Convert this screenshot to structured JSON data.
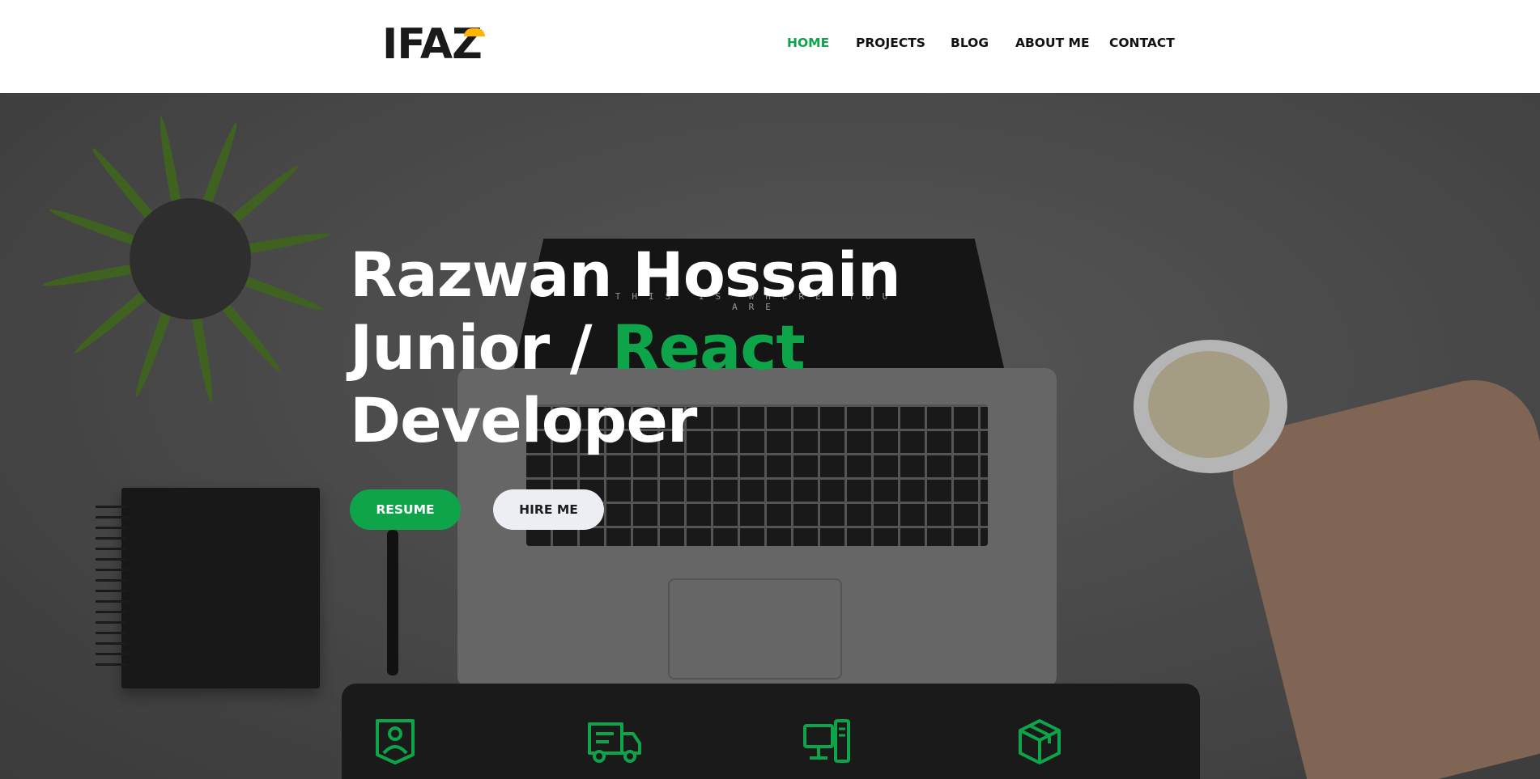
{
  "brand": {
    "logo_text": "IFAZ",
    "logo_accent_color": "#ffb400"
  },
  "nav": {
    "items": [
      {
        "label": "HOME",
        "active": true
      },
      {
        "label": "PROJECTS",
        "active": false
      },
      {
        "label": "BLOG",
        "active": false
      },
      {
        "label": "ABOUT ME",
        "active": false
      },
      {
        "label": "CONTACT",
        "active": false
      }
    ]
  },
  "hero": {
    "title_line1": "Razwan Hossain",
    "title_line2_prefix": "Junior / ",
    "title_line2_accent": "React",
    "title_line3": "Developer",
    "screen_text": "THIS IS WHERE YOU ARE",
    "resume_label": "RESUME",
    "hire_label": "HIRE ME"
  },
  "features": {
    "icons": [
      "id-badge-icon",
      "delivery-truck-icon",
      "computer-desktop-icon",
      "package-box-icon"
    ]
  },
  "colors": {
    "accent": "#0ea44a",
    "nav_text": "#111111",
    "panel_bg": "#1a1a1a"
  }
}
